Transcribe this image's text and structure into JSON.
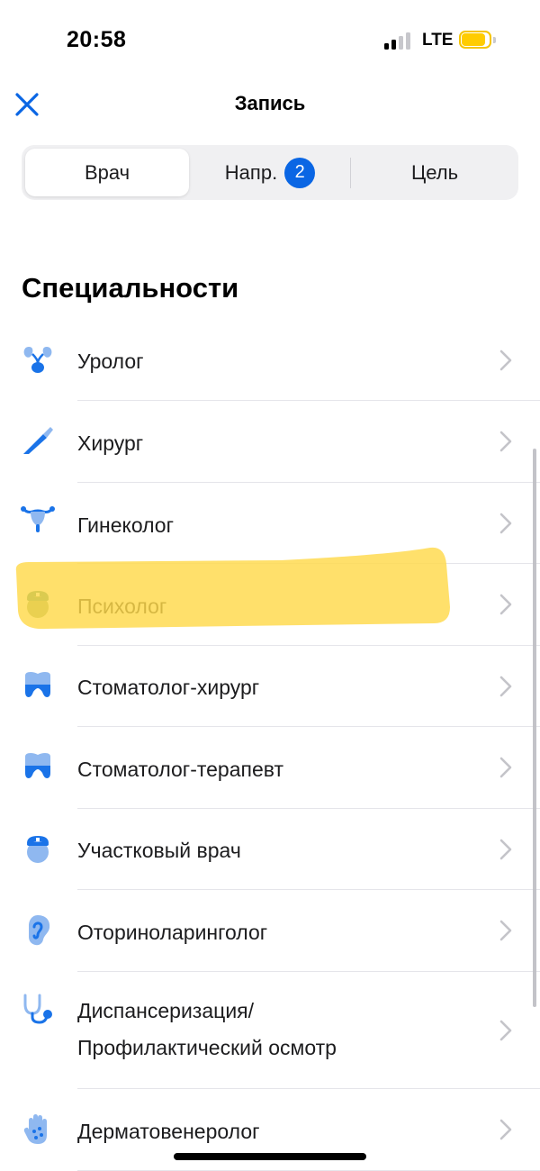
{
  "status": {
    "time": "20:58",
    "network": "LTE",
    "battery_color": "#ffcc00"
  },
  "nav": {
    "close_icon": "close-x-icon",
    "title": "Запись"
  },
  "segments": [
    {
      "label": "Врач",
      "selected": true
    },
    {
      "label": "Напр.",
      "badge": "2"
    },
    {
      "label": "Цель"
    }
  ],
  "section_title": "Специальности",
  "specialties": [
    {
      "icon": "kidney-icon",
      "label": "Уролог"
    },
    {
      "icon": "scalpel-icon",
      "label": "Хирург"
    },
    {
      "icon": "uterus-icon",
      "label": "Гинеколог"
    },
    {
      "icon": "doctor-face-icon",
      "label": "Психолог"
    },
    {
      "icon": "tooth-icon",
      "label": "Стоматолог-хирург"
    },
    {
      "icon": "tooth-icon",
      "label": "Стоматолог-терапевт"
    },
    {
      "icon": "doctor-face-icon",
      "label": "Участковый врач"
    },
    {
      "icon": "ear-icon",
      "label": "Оториноларинголог"
    },
    {
      "icon": "stethoscope-icon",
      "label_line1": "Диспансеризация/",
      "label_line2": "Профилактический осмотр"
    },
    {
      "icon": "hand-icon",
      "label": "Дерматовенеролог"
    }
  ],
  "colors": {
    "accent": "#0a66e4",
    "icon_blue": "#1a73e8",
    "highlight": "#ffd94a"
  }
}
